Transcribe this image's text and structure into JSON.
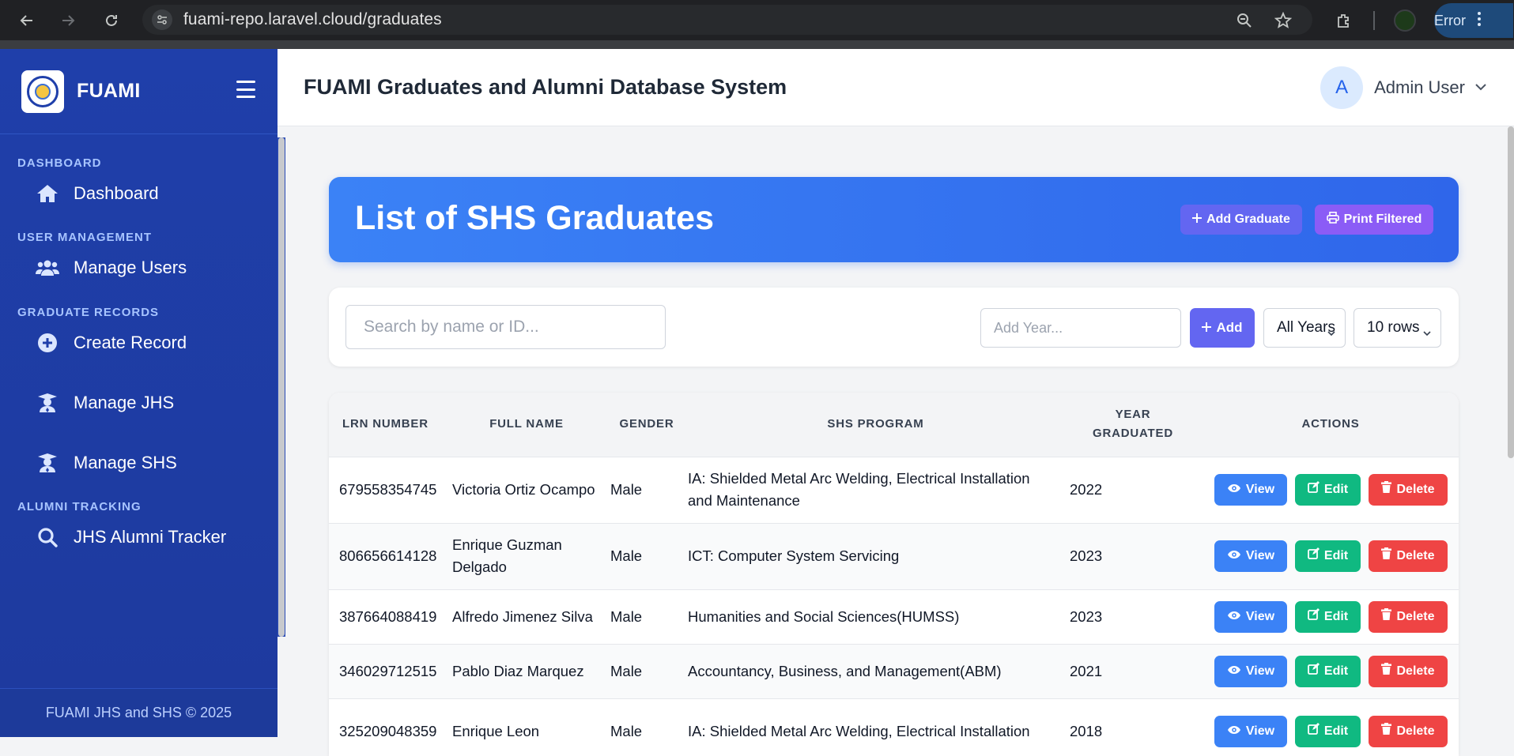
{
  "browser": {
    "url_host": "fuami-repo.laravel.cloud",
    "url_path": "/graduates",
    "error_label": "Error"
  },
  "sidebar": {
    "brand": "FUAMI",
    "sections": [
      {
        "title": "DASHBOARD",
        "items": [
          {
            "label": "Dashboard",
            "icon": "home-icon"
          }
        ]
      },
      {
        "title": "USER MANAGEMENT",
        "items": [
          {
            "label": "Manage Users",
            "icon": "users-icon"
          }
        ]
      },
      {
        "title": "GRADUATE RECORDS",
        "items": [
          {
            "label": "Create Record",
            "icon": "plus-circle-icon"
          },
          {
            "label": "Manage JHS",
            "icon": "graduate-icon"
          },
          {
            "label": "Manage SHS",
            "icon": "graduate-icon"
          }
        ]
      },
      {
        "title": "ALUMNI TRACKING",
        "items": [
          {
            "label": "JHS Alumni Tracker",
            "icon": "search-icon"
          }
        ]
      }
    ],
    "footer": "FUAMI JHS and SHS © 2025"
  },
  "topbar": {
    "title": "FUAMI Graduates and Alumni Database System",
    "avatar_initial": "A",
    "user_name": "Admin User"
  },
  "hero": {
    "title": "List of SHS Graduates",
    "add_graduate": "Add Graduate",
    "print_filtered": "Print Filtered"
  },
  "filters": {
    "search_placeholder": "Search by name or ID...",
    "year_placeholder": "Add Year...",
    "add_label": "Add",
    "year_select": "All Years",
    "rows_select": "10 rows"
  },
  "table": {
    "headers": {
      "lrn": "LRN NUMBER",
      "name": "FULL NAME",
      "gender": "GENDER",
      "program": "SHS PROGRAM",
      "year_line1": "YEAR",
      "year_line2": "GRADUATED",
      "actions": "ACTIONS"
    },
    "actions": {
      "view": "View",
      "edit": "Edit",
      "delete": "Delete"
    },
    "rows": [
      {
        "lrn": "679558354745",
        "name": "Victoria Ortiz Ocampo",
        "gender": "Male",
        "program": "IA: Shielded Metal Arc Welding, Electrical Installation and Maintenance",
        "year": "2022"
      },
      {
        "lrn": "806656614128",
        "name": "Enrique Guzman Delgado",
        "gender": "Male",
        "program": "ICT: Computer System Servicing",
        "year": "2023"
      },
      {
        "lrn": "387664088419",
        "name": "Alfredo Jimenez Silva",
        "gender": "Male",
        "program": "Humanities and Social Sciences(HUMSS)",
        "year": "2023"
      },
      {
        "lrn": "346029712515",
        "name": "Pablo Diaz Marquez",
        "gender": "Male",
        "program": "Accountancy, Business, and Management(ABM)",
        "year": "2021"
      },
      {
        "lrn": "325209048359",
        "name": "Enrique Leon",
        "gender": "Male",
        "program": "IA: Shielded Metal Arc Welding, Electrical Installation",
        "year": "2018"
      }
    ]
  },
  "colors": {
    "sidebar": "#1f3faa",
    "hero": "#3b82f6",
    "indigo": "#6366f1",
    "purple": "#8b5cf6",
    "view": "#3b82f6",
    "edit": "#10b981",
    "delete": "#ef4444"
  }
}
